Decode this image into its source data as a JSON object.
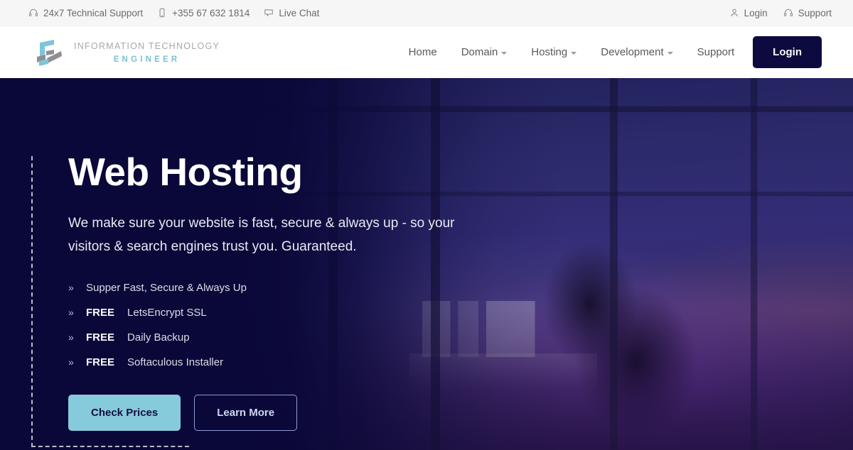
{
  "topbar": {
    "left_items": [
      {
        "icon": "headset-icon",
        "label": "24x7 Technical Support"
      },
      {
        "icon": "mobile-phone-icon",
        "label": "+355 67 632 1814"
      },
      {
        "icon": "chat-bubble-icon",
        "label": "Live Chat"
      }
    ],
    "right_items": [
      {
        "icon": "user-icon",
        "label": "Login"
      },
      {
        "icon": "headset-icon",
        "label": "Support"
      }
    ]
  },
  "brand": {
    "line1": "INFORMATION TECHNOLOGY",
    "line2": "ENGINEER",
    "mark_colors": {
      "teal": "#7cc6da",
      "gray": "#8f8f93"
    }
  },
  "nav": {
    "items": [
      {
        "label": "Home",
        "has_dropdown": false
      },
      {
        "label": "Domain",
        "has_dropdown": true
      },
      {
        "label": "Hosting",
        "has_dropdown": true
      },
      {
        "label": "Development",
        "has_dropdown": true
      },
      {
        "label": "Support",
        "has_dropdown": false
      }
    ],
    "login_label": "Login",
    "login_bg": "#0c0a3e"
  },
  "hero": {
    "title": "Web Hosting",
    "subtitle": "We make sure your website is fast, secure & always up - so your visitors & search engines trust you. Guaranteed.",
    "features": [
      {
        "free": "",
        "text": "Supper Fast, Secure & Always Up"
      },
      {
        "free": "FREE",
        "text": "LetsEncrypt SSL"
      },
      {
        "free": "FREE",
        "text": "Daily Backup"
      },
      {
        "free": "FREE",
        "text": "Softaculous Installer"
      }
    ],
    "primary_cta": "Check Prices",
    "secondary_cta": "Learn More",
    "primary_cta_bg": "#86cbdc",
    "background_color": "#0a0838"
  }
}
